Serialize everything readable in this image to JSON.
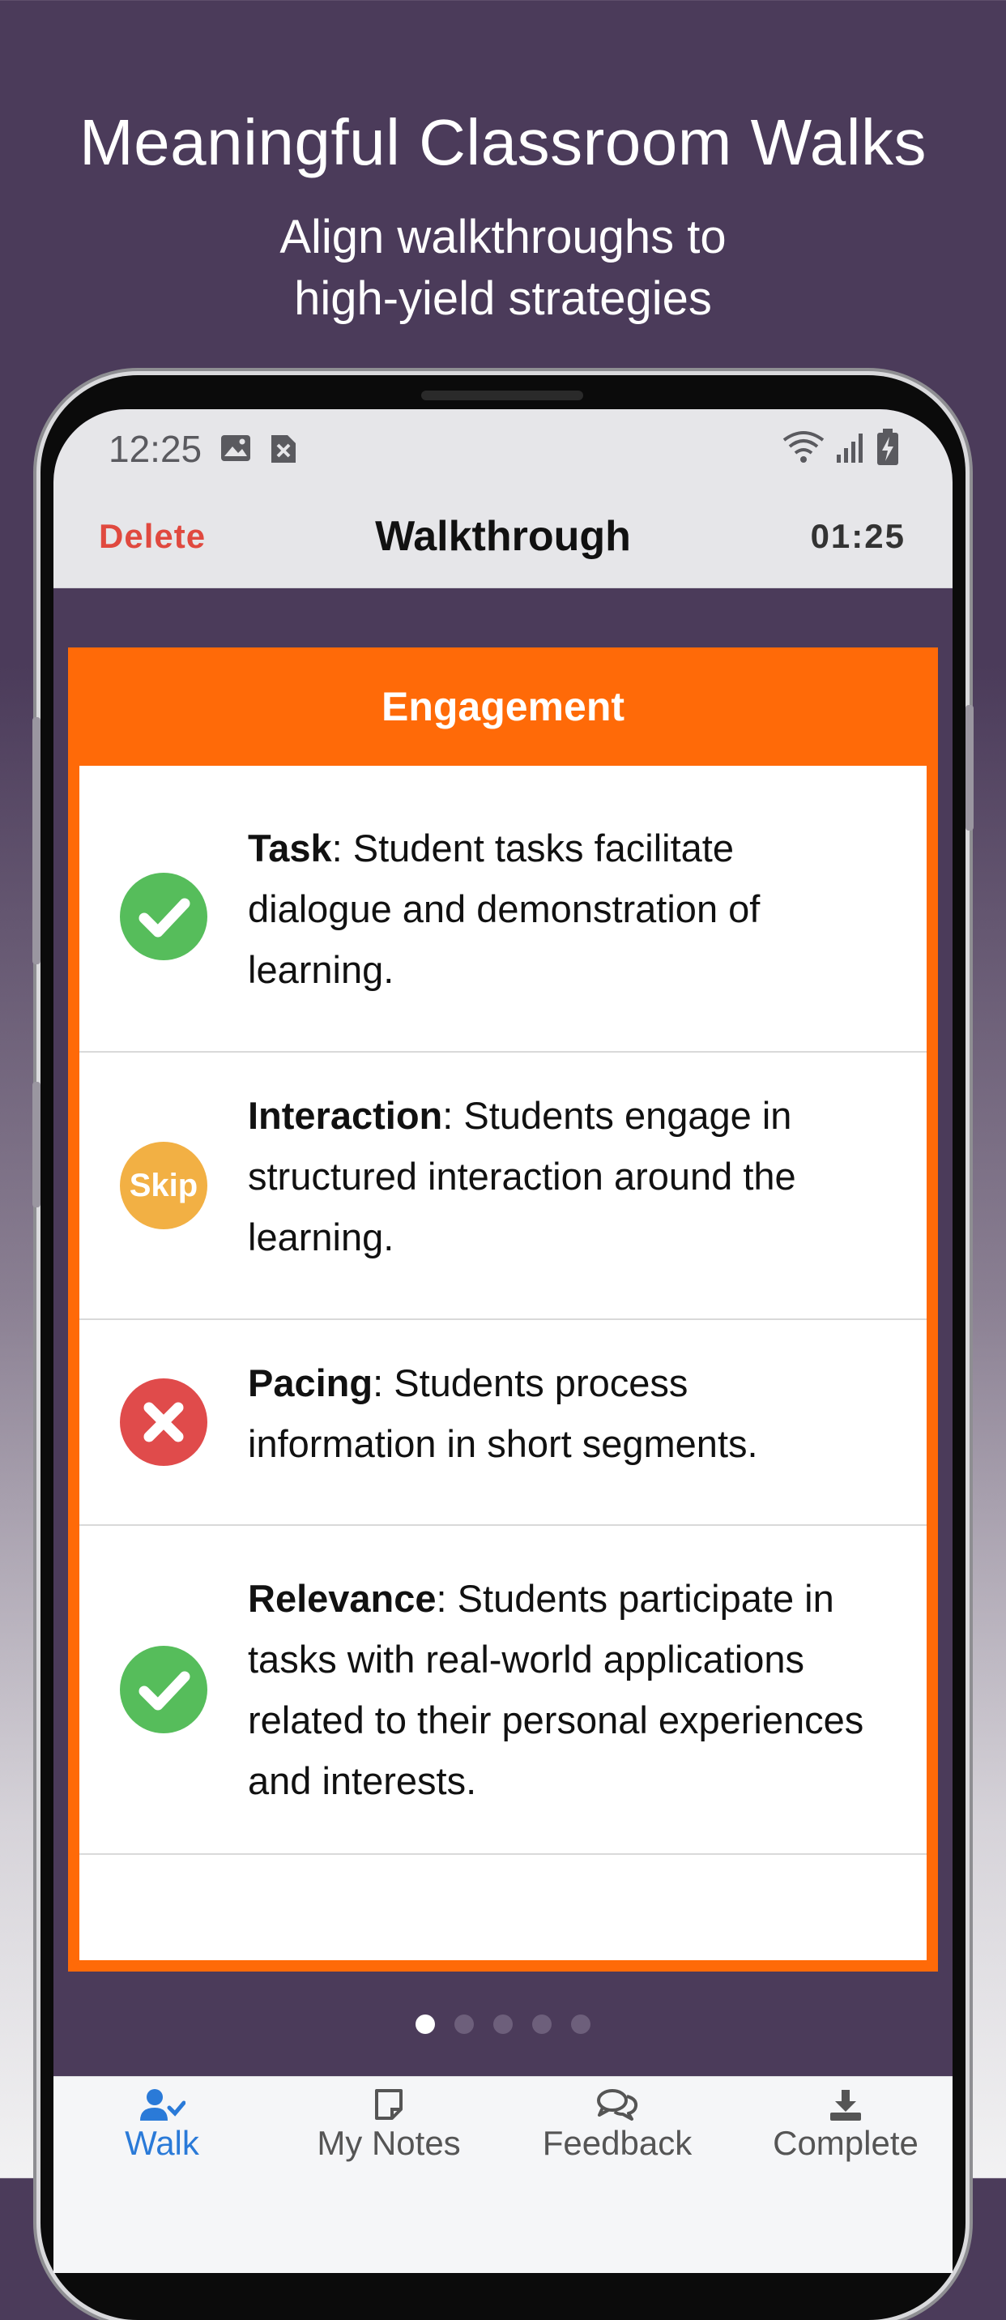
{
  "promo": {
    "headline": "Meaningful Classroom Walks",
    "subline_1": "Align walkthroughs to",
    "subline_2": "high-yield strategies"
  },
  "status_bar": {
    "time": "12:25"
  },
  "nav": {
    "delete_label": "Delete",
    "title": "Walkthrough",
    "timer": "01:25"
  },
  "card": {
    "header": "Engagement",
    "items": [
      {
        "term": "Task",
        "desc": ":  Student tasks facilitate dialogue and demonstration of learning.",
        "status": "check"
      },
      {
        "term": "Interaction",
        "desc": ":  Students engage in structured interaction around the learning.",
        "status": "skip",
        "status_label": "Skip"
      },
      {
        "term": "Pacing",
        "desc": ":  Students process information in short segments.",
        "status": "x"
      },
      {
        "term": "Relevance",
        "desc": ":  Students participate in tasks with real-world applications related to their personal experiences and interests.",
        "status": "check"
      }
    ]
  },
  "pager": {
    "pages": 5,
    "current_page": 1
  },
  "tabbar": {
    "tabs": [
      {
        "label": "Walk",
        "icon": "user-check-icon",
        "active": true
      },
      {
        "label": "My Notes",
        "icon": "note-icon",
        "active": false
      },
      {
        "label": "Feedback",
        "icon": "chat-bubbles-icon",
        "active": false
      },
      {
        "label": "Complete",
        "icon": "download-icon",
        "active": false
      }
    ]
  },
  "colors": {
    "background": "#4b3b5a",
    "accent_orange": "#ff6a08",
    "check_green": "#56bd5b",
    "skip_amber": "#f2b044",
    "x_red": "#e04b4b",
    "delete_red": "#e0493f",
    "active_tab_blue": "#2a7ad8"
  }
}
